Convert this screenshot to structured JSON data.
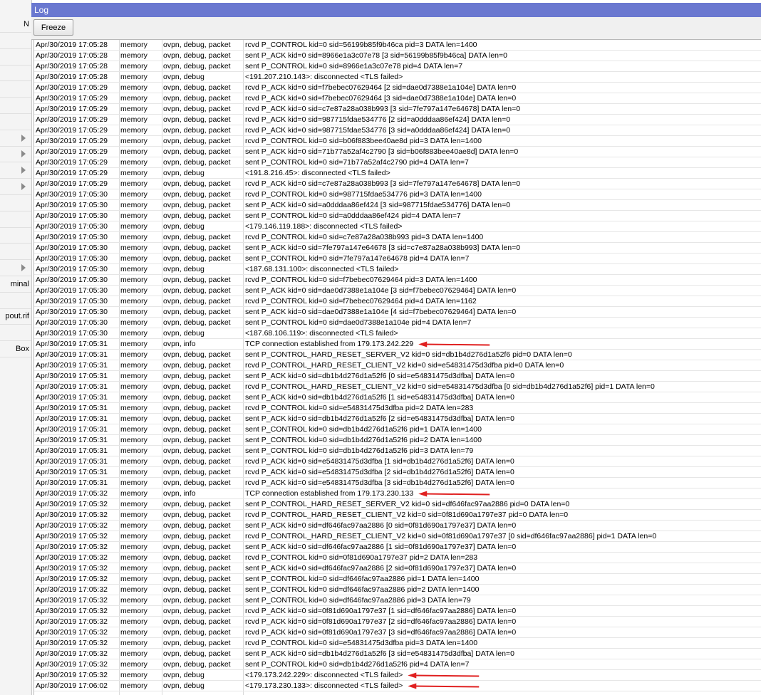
{
  "window": {
    "title": "Log"
  },
  "toolbar": {
    "freeze_label": "Freeze"
  },
  "sidebar": {
    "items": [
      {
        "label": "N",
        "arrow": false
      },
      {
        "label": "",
        "arrow": false
      },
      {
        "label": "",
        "arrow": false
      },
      {
        "label": "",
        "arrow": false
      },
      {
        "label": "",
        "arrow": false
      },
      {
        "label": "",
        "arrow": false
      },
      {
        "label": "",
        "arrow": false
      },
      {
        "label": "",
        "arrow": true
      },
      {
        "label": "",
        "arrow": true
      },
      {
        "label": "",
        "arrow": true
      },
      {
        "label": "",
        "arrow": true
      },
      {
        "label": "",
        "arrow": false
      },
      {
        "label": "",
        "arrow": false
      },
      {
        "label": "",
        "arrow": false
      },
      {
        "label": "",
        "arrow": false
      },
      {
        "label": "",
        "arrow": true
      },
      {
        "label": "minal",
        "arrow": false
      },
      {
        "label": "",
        "arrow": false
      },
      {
        "label": "pout.rif",
        "arrow": false
      },
      {
        "label": "",
        "arrow": false
      },
      {
        "label": "Box",
        "arrow": false
      }
    ]
  },
  "log": {
    "rows": [
      [
        "Apr/30/2019 17:05:28",
        "memory",
        "ovpn, debug, packet",
        "rcvd P_CONTROL kid=0 sid=56199b85f9b46ca pid=3 DATA len=1400"
      ],
      [
        "Apr/30/2019 17:05:28",
        "memory",
        "ovpn, debug, packet",
        "sent P_ACK kid=0 sid=8966e1a3c07e78 [3 sid=56199b85f9b46ca] DATA len=0"
      ],
      [
        "Apr/30/2019 17:05:28",
        "memory",
        "ovpn, debug, packet",
        "sent P_CONTROL kid=0 sid=8966e1a3c07e78 pid=4 DATA len=7"
      ],
      [
        "Apr/30/2019 17:05:28",
        "memory",
        "ovpn, debug",
        "<191.207.210.143>: disconnected <TLS failed>"
      ],
      [
        "Apr/30/2019 17:05:29",
        "memory",
        "ovpn, debug, packet",
        "rcvd P_ACK kid=0 sid=f7bebec07629464 [2 sid=dae0d7388e1a104e] DATA len=0"
      ],
      [
        "Apr/30/2019 17:05:29",
        "memory",
        "ovpn, debug, packet",
        "rcvd P_ACK kid=0 sid=f7bebec07629464 [3 sid=dae0d7388e1a104e] DATA len=0"
      ],
      [
        "Apr/30/2019 17:05:29",
        "memory",
        "ovpn, debug, packet",
        "rcvd P_ACK kid=0 sid=c7e87a28a038b993 [3 sid=7fe797a147e64678] DATA len=0"
      ],
      [
        "Apr/30/2019 17:05:29",
        "memory",
        "ovpn, debug, packet",
        "rcvd P_ACK kid=0 sid=987715fdae534776 [2 sid=a0dddaa86ef424] DATA len=0"
      ],
      [
        "Apr/30/2019 17:05:29",
        "memory",
        "ovpn, debug, packet",
        "rcvd P_ACK kid=0 sid=987715fdae534776 [3 sid=a0dddaa86ef424] DATA len=0"
      ],
      [
        "Apr/30/2019 17:05:29",
        "memory",
        "ovpn, debug, packet",
        "rcvd P_CONTROL kid=0 sid=b06f883bee40ae8d pid=3 DATA len=1400"
      ],
      [
        "Apr/30/2019 17:05:29",
        "memory",
        "ovpn, debug, packet",
        "sent P_ACK kid=0 sid=71b77a52af4c2790 [3 sid=b06f883bee40ae8d] DATA len=0"
      ],
      [
        "Apr/30/2019 17:05:29",
        "memory",
        "ovpn, debug, packet",
        "sent P_CONTROL kid=0 sid=71b77a52af4c2790 pid=4 DATA len=7"
      ],
      [
        "Apr/30/2019 17:05:29",
        "memory",
        "ovpn, debug",
        "<191.8.216.45>: disconnected <TLS failed>"
      ],
      [
        "Apr/30/2019 17:05:29",
        "memory",
        "ovpn, debug, packet",
        "rcvd P_ACK kid=0 sid=c7e87a28a038b993 [3 sid=7fe797a147e64678] DATA len=0"
      ],
      [
        "Apr/30/2019 17:05:30",
        "memory",
        "ovpn, debug, packet",
        "rcvd P_CONTROL kid=0 sid=987715fdae534776 pid=3 DATA len=1400"
      ],
      [
        "Apr/30/2019 17:05:30",
        "memory",
        "ovpn, debug, packet",
        "sent P_ACK kid=0 sid=a0dddaa86ef424 [3 sid=987715fdae534776] DATA len=0"
      ],
      [
        "Apr/30/2019 17:05:30",
        "memory",
        "ovpn, debug, packet",
        "sent P_CONTROL kid=0 sid=a0dddaa86ef424 pid=4 DATA len=7"
      ],
      [
        "Apr/30/2019 17:05:30",
        "memory",
        "ovpn, debug",
        "<179.146.119.188>: disconnected <TLS failed>"
      ],
      [
        "Apr/30/2019 17:05:30",
        "memory",
        "ovpn, debug, packet",
        "rcvd P_CONTROL kid=0 sid=c7e87a28a038b993 pid=3 DATA len=1400"
      ],
      [
        "Apr/30/2019 17:05:30",
        "memory",
        "ovpn, debug, packet",
        "sent P_ACK kid=0 sid=7fe797a147e64678 [3 sid=c7e87a28a038b993] DATA len=0"
      ],
      [
        "Apr/30/2019 17:05:30",
        "memory",
        "ovpn, debug, packet",
        "sent P_CONTROL kid=0 sid=7fe797a147e64678 pid=4 DATA len=7"
      ],
      [
        "Apr/30/2019 17:05:30",
        "memory",
        "ovpn, debug",
        "<187.68.131.100>: disconnected <TLS failed>"
      ],
      [
        "Apr/30/2019 17:05:30",
        "memory",
        "ovpn, debug, packet",
        "rcvd P_CONTROL kid=0 sid=f7bebec07629464 pid=3 DATA len=1400"
      ],
      [
        "Apr/30/2019 17:05:30",
        "memory",
        "ovpn, debug, packet",
        "sent P_ACK kid=0 sid=dae0d7388e1a104e [3 sid=f7bebec07629464] DATA len=0"
      ],
      [
        "Apr/30/2019 17:05:30",
        "memory",
        "ovpn, debug, packet",
        "rcvd P_CONTROL kid=0 sid=f7bebec07629464 pid=4 DATA len=1162"
      ],
      [
        "Apr/30/2019 17:05:30",
        "memory",
        "ovpn, debug, packet",
        "sent P_ACK kid=0 sid=dae0d7388e1a104e [4 sid=f7bebec07629464] DATA len=0"
      ],
      [
        "Apr/30/2019 17:05:30",
        "memory",
        "ovpn, debug, packet",
        "sent P_CONTROL kid=0 sid=dae0d7388e1a104e pid=4 DATA len=7"
      ],
      [
        "Apr/30/2019 17:05:30",
        "memory",
        "ovpn, debug",
        "<187.68.106.119>: disconnected <TLS failed>"
      ],
      [
        "Apr/30/2019 17:05:31",
        "memory",
        "ovpn, info",
        "TCP connection established from 179.173.242.229"
      ],
      [
        "Apr/30/2019 17:05:31",
        "memory",
        "ovpn, debug, packet",
        "sent P_CONTROL_HARD_RESET_SERVER_V2 kid=0 sid=db1b4d276d1a52f6 pid=0 DATA len=0"
      ],
      [
        "Apr/30/2019 17:05:31",
        "memory",
        "ovpn, debug, packet",
        "rcvd P_CONTROL_HARD_RESET_CLIENT_V2 kid=0 sid=e54831475d3dfba pid=0 DATA len=0"
      ],
      [
        "Apr/30/2019 17:05:31",
        "memory",
        "ovpn, debug, packet",
        "sent P_ACK kid=0 sid=db1b4d276d1a52f6 [0 sid=e54831475d3dfba] DATA len=0"
      ],
      [
        "Apr/30/2019 17:05:31",
        "memory",
        "ovpn, debug, packet",
        "rcvd P_CONTROL_HARD_RESET_CLIENT_V2 kid=0 sid=e54831475d3dfba [0 sid=db1b4d276d1a52f6] pid=1 DATA len=0"
      ],
      [
        "Apr/30/2019 17:05:31",
        "memory",
        "ovpn, debug, packet",
        "sent P_ACK kid=0 sid=db1b4d276d1a52f6 [1 sid=e54831475d3dfba] DATA len=0"
      ],
      [
        "Apr/30/2019 17:05:31",
        "memory",
        "ovpn, debug, packet",
        "rcvd P_CONTROL kid=0 sid=e54831475d3dfba pid=2 DATA len=283"
      ],
      [
        "Apr/30/2019 17:05:31",
        "memory",
        "ovpn, debug, packet",
        "sent P_ACK kid=0 sid=db1b4d276d1a52f6 [2 sid=e54831475d3dfba] DATA len=0"
      ],
      [
        "Apr/30/2019 17:05:31",
        "memory",
        "ovpn, debug, packet",
        "sent P_CONTROL kid=0 sid=db1b4d276d1a52f6 pid=1 DATA len=1400"
      ],
      [
        "Apr/30/2019 17:05:31",
        "memory",
        "ovpn, debug, packet",
        "sent P_CONTROL kid=0 sid=db1b4d276d1a52f6 pid=2 DATA len=1400"
      ],
      [
        "Apr/30/2019 17:05:31",
        "memory",
        "ovpn, debug, packet",
        "sent P_CONTROL kid=0 sid=db1b4d276d1a52f6 pid=3 DATA len=79"
      ],
      [
        "Apr/30/2019 17:05:31",
        "memory",
        "ovpn, debug, packet",
        "rcvd P_ACK kid=0 sid=e54831475d3dfba [1 sid=db1b4d276d1a52f6] DATA len=0"
      ],
      [
        "Apr/30/2019 17:05:31",
        "memory",
        "ovpn, debug, packet",
        "rcvd P_ACK kid=0 sid=e54831475d3dfba [2 sid=db1b4d276d1a52f6] DATA len=0"
      ],
      [
        "Apr/30/2019 17:05:31",
        "memory",
        "ovpn, debug, packet",
        "rcvd P_ACK kid=0 sid=e54831475d3dfba [3 sid=db1b4d276d1a52f6] DATA len=0"
      ],
      [
        "Apr/30/2019 17:05:32",
        "memory",
        "ovpn, info",
        "TCP connection established from 179.173.230.133"
      ],
      [
        "Apr/30/2019 17:05:32",
        "memory",
        "ovpn, debug, packet",
        "sent P_CONTROL_HARD_RESET_SERVER_V2 kid=0 sid=df646fac97aa2886 pid=0 DATA len=0"
      ],
      [
        "Apr/30/2019 17:05:32",
        "memory",
        "ovpn, debug, packet",
        "rcvd P_CONTROL_HARD_RESET_CLIENT_V2 kid=0 sid=0f81d690a1797e37 pid=0 DATA len=0"
      ],
      [
        "Apr/30/2019 17:05:32",
        "memory",
        "ovpn, debug, packet",
        "sent P_ACK kid=0 sid=df646fac97aa2886 [0 sid=0f81d690a1797e37] DATA len=0"
      ],
      [
        "Apr/30/2019 17:05:32",
        "memory",
        "ovpn, debug, packet",
        "rcvd P_CONTROL_HARD_RESET_CLIENT_V2 kid=0 sid=0f81d690a1797e37 [0 sid=df646fac97aa2886] pid=1 DATA len=0"
      ],
      [
        "Apr/30/2019 17:05:32",
        "memory",
        "ovpn, debug, packet",
        "sent P_ACK kid=0 sid=df646fac97aa2886 [1 sid=0f81d690a1797e37] DATA len=0"
      ],
      [
        "Apr/30/2019 17:05:32",
        "memory",
        "ovpn, debug, packet",
        "rcvd P_CONTROL kid=0 sid=0f81d690a1797e37 pid=2 DATA len=283"
      ],
      [
        "Apr/30/2019 17:05:32",
        "memory",
        "ovpn, debug, packet",
        "sent P_ACK kid=0 sid=df646fac97aa2886 [2 sid=0f81d690a1797e37] DATA len=0"
      ],
      [
        "Apr/30/2019 17:05:32",
        "memory",
        "ovpn, debug, packet",
        "sent P_CONTROL kid=0 sid=df646fac97aa2886 pid=1 DATA len=1400"
      ],
      [
        "Apr/30/2019 17:05:32",
        "memory",
        "ovpn, debug, packet",
        "sent P_CONTROL kid=0 sid=df646fac97aa2886 pid=2 DATA len=1400"
      ],
      [
        "Apr/30/2019 17:05:32",
        "memory",
        "ovpn, debug, packet",
        "sent P_CONTROL kid=0 sid=df646fac97aa2886 pid=3 DATA len=79"
      ],
      [
        "Apr/30/2019 17:05:32",
        "memory",
        "ovpn, debug, packet",
        "rcvd P_ACK kid=0 sid=0f81d690a1797e37 [1 sid=df646fac97aa2886] DATA len=0"
      ],
      [
        "Apr/30/2019 17:05:32",
        "memory",
        "ovpn, debug, packet",
        "rcvd P_ACK kid=0 sid=0f81d690a1797e37 [2 sid=df646fac97aa2886] DATA len=0"
      ],
      [
        "Apr/30/2019 17:05:32",
        "memory",
        "ovpn, debug, packet",
        "rcvd P_ACK kid=0 sid=0f81d690a1797e37 [3 sid=df646fac97aa2886] DATA len=0"
      ],
      [
        "Apr/30/2019 17:05:32",
        "memory",
        "ovpn, debug, packet",
        "rcvd P_CONTROL kid=0 sid=e54831475d3dfba pid=3 DATA len=1400"
      ],
      [
        "Apr/30/2019 17:05:32",
        "memory",
        "ovpn, debug, packet",
        "sent P_ACK kid=0 sid=db1b4d276d1a52f6 [3 sid=e54831475d3dfba] DATA len=0"
      ],
      [
        "Apr/30/2019 17:05:32",
        "memory",
        "ovpn, debug, packet",
        "sent P_CONTROL kid=0 sid=db1b4d276d1a52f6 pid=4 DATA len=7"
      ],
      [
        "Apr/30/2019 17:05:32",
        "memory",
        "ovpn, debug",
        "<179.173.242.229>: disconnected <TLS failed>"
      ],
      [
        "Apr/30/2019 17:06:02",
        "memory",
        "ovpn, debug",
        "<179.173.230.133>: disconnected <TLS failed>"
      ]
    ],
    "highlighted_rows": [
      28,
      42,
      59,
      60
    ]
  },
  "annotation_color": "#e02020",
  "title_bar_color": "#6a78d0"
}
